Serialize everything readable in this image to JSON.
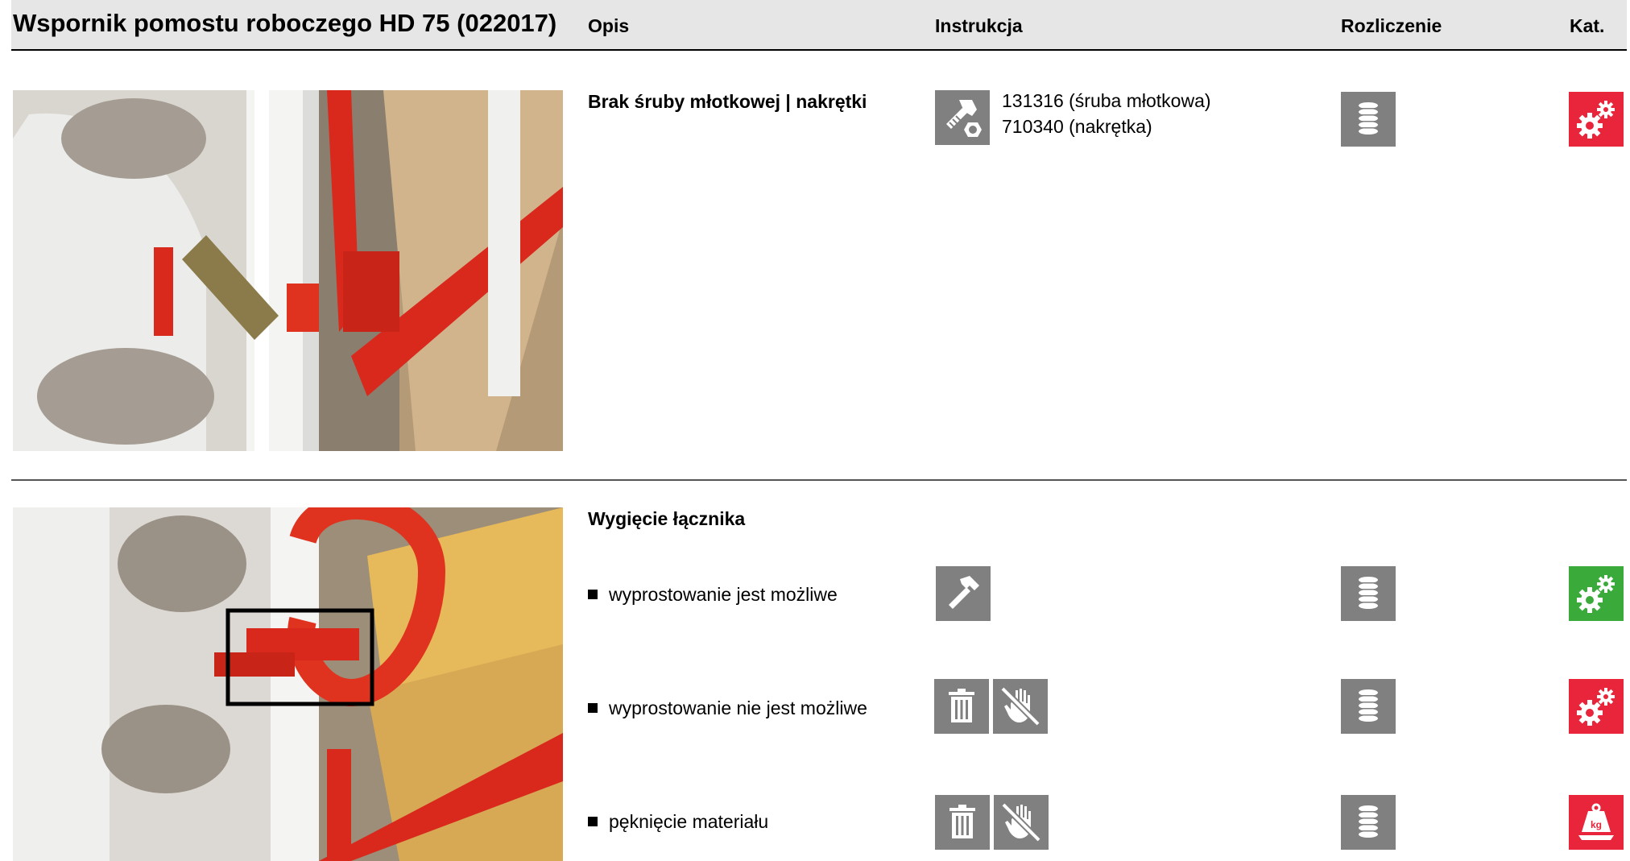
{
  "header": {
    "title": "Wspornik pomostu roboczego HD 75 (022017)",
    "col_opis": "Opis",
    "col_instrukcja": "Instrukcja",
    "col_rozliczenie": "Rozliczenie",
    "col_kat": "Kat."
  },
  "section1": {
    "description": "Brak śruby młotkowej | nakrętki",
    "instruction_lines": [
      "131316 (śruba młotkowa)",
      "710340 (nakrętka)"
    ],
    "icons": {
      "instruction": "bolt-nut-icon",
      "billing": "stack-icon",
      "category": "gears-icon"
    },
    "category_color": "#e8253a"
  },
  "section2": {
    "description": "Wygięcie łącznika",
    "items": [
      {
        "label": "wyprostowanie jest możliwe",
        "instruction_icons": [
          "hammer-icon"
        ],
        "billing_icon": "stack-icon",
        "category_icon": "gears-icon",
        "category_color": "#3aaa3a"
      },
      {
        "label": "wyprostowanie nie jest możliwe",
        "instruction_icons": [
          "trash-icon",
          "no-repair-icon"
        ],
        "billing_icon": "stack-icon",
        "category_icon": "gears-icon",
        "category_color": "#e8253a"
      },
      {
        "label": "pęknięcie materiału",
        "instruction_icons": [
          "trash-icon",
          "no-repair-icon"
        ],
        "billing_icon": "stack-icon",
        "category_icon": "weight-kg-icon",
        "category_color": "#e8253a"
      }
    ],
    "weight_label": "kg"
  },
  "colors": {
    "icon_gray": "#808080",
    "red": "#e8253a",
    "green": "#3aaa3a"
  }
}
